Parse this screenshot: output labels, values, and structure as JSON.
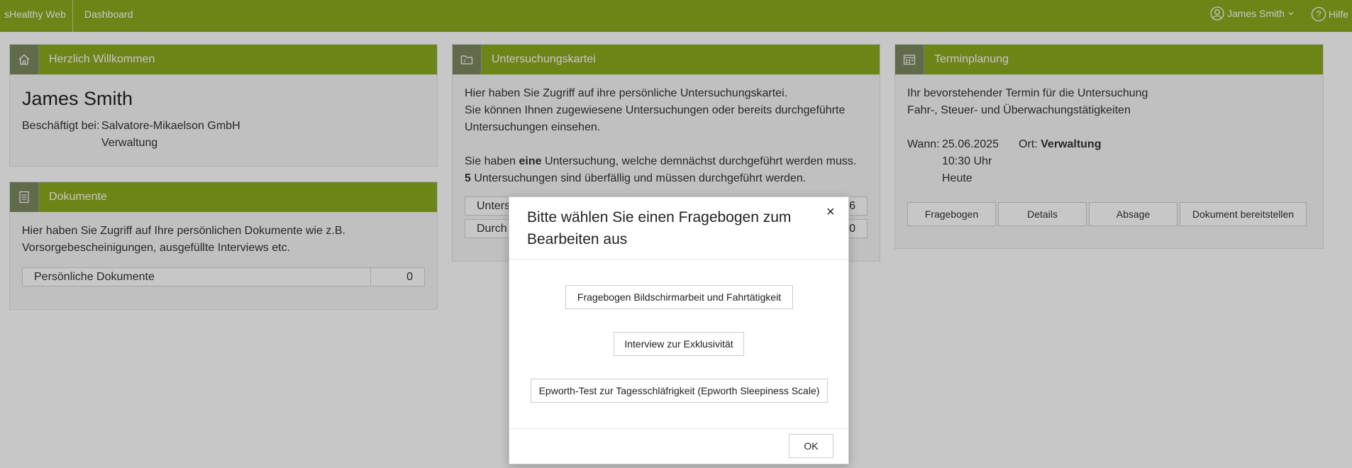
{
  "topbar": {
    "brand": "sHealthy Web",
    "nav_dashboard": "Dashboard",
    "user_name": "James Smith",
    "help": "Hilfe"
  },
  "welcome": {
    "title": "Herzlich Willkommen",
    "name": "James Smith",
    "employed_label": "Beschäftigt bei:",
    "company": "Salvatore-Mikaelson GmbH",
    "department": "Verwaltung"
  },
  "documents": {
    "title": "Dokumente",
    "text_line1": "Hier haben Sie Zugriff auf Ihre persönlichen Dokumente wie z.B.",
    "text_line2": "Vorsorgebescheinigungen, ausgefüllte Interviews etc.",
    "rows": [
      {
        "label": "Persönliche Dokumente",
        "count": "0"
      }
    ]
  },
  "exams": {
    "title": "Untersuchungskartei",
    "line1": "Hier haben Sie Zugriff auf ihre persönliche Untersuchungskartei.",
    "line2": "Sie können Ihnen zugewiesene Untersuchungen oder bereits durchgeführte",
    "line3": "Untersuchungen einsehen.",
    "line4_pre": "Sie haben ",
    "line4_bold": "eine",
    "line4_post": " Untersuchung, welche demnächst durchgeführt werden muss.",
    "line5_bold": "5",
    "line5_post": " Untersuchungen sind überfällig und müssen durchgeführt werden.",
    "rows": [
      {
        "label": "Unters",
        "count": "6"
      },
      {
        "label": "Durch",
        "count": "0"
      }
    ]
  },
  "appointments": {
    "title": "Terminplanung",
    "line1": "Ihr bevorstehender Termin für die Untersuchung",
    "line2": "Fahr-, Steuer- und Überwachungstätigkeiten",
    "when_label": "Wann:",
    "date": "25.06.2025",
    "time": "10:30 Uhr",
    "day": "Heute",
    "where_label": "Ort:",
    "where_value": "Verwaltung",
    "buttons": [
      "Fragebogen",
      "Details",
      "Absage",
      "Dokument bereitstellen"
    ]
  },
  "modal": {
    "title": "Bitte wählen Sie einen Fragebogen zum Bearbeiten aus",
    "close": "×",
    "options": [
      "Fragebogen Bildschirmarbeit und Fahrtätigkeit",
      "Interview zur Exklusivität",
      "Epworth-Test zur Tagesschläfrigkeit (Epworth Sleepiness Scale)"
    ],
    "ok": "OK"
  },
  "colors": {
    "accent": "#8caa1e",
    "icon_box": "#7d8a62"
  }
}
